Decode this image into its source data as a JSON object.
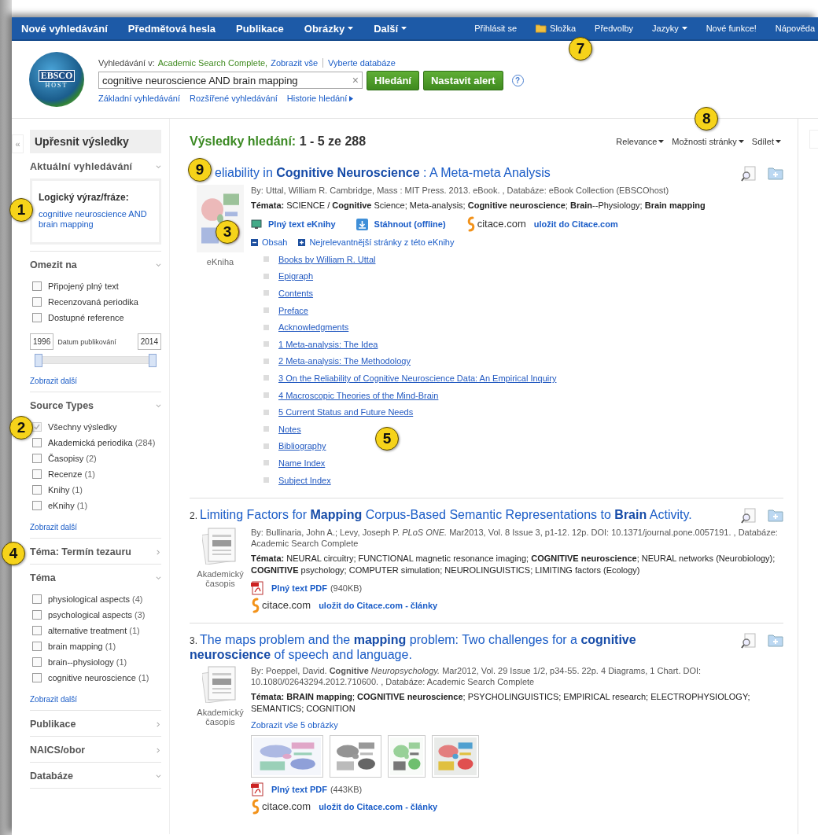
{
  "nav": {
    "left": [
      {
        "label": "Nové vyhledávání",
        "dropdown": false
      },
      {
        "label": "Předmětová hesla",
        "dropdown": false
      },
      {
        "label": "Publikace",
        "dropdown": false
      },
      {
        "label": "Obrázky",
        "dropdown": true
      },
      {
        "label": "Další",
        "dropdown": true
      }
    ],
    "right": [
      {
        "kind": "link",
        "label": "Přihlásit se",
        "dropdown": false
      },
      {
        "kind": "folder",
        "label": "Složka",
        "dropdown": false,
        "callout": "7"
      },
      {
        "kind": "link",
        "label": "Předvolby",
        "dropdown": false
      },
      {
        "kind": "link",
        "label": "Jazyky",
        "dropdown": true
      },
      {
        "kind": "link",
        "label": "Nové funkce!",
        "dropdown": false
      },
      {
        "kind": "link",
        "label": "Nápověda",
        "dropdown": false
      }
    ]
  },
  "header": {
    "logo": {
      "line1": "EBSCO",
      "line2": "HOST"
    },
    "prefix": "Vyhledávání v:",
    "database": "Academic Search Complete,",
    "show_all": "Zobrazit vše",
    "choose": "Vyberte databáze",
    "query": "cognitive neuroscience AND brain mapping",
    "clear": "×",
    "search_button": "Hledání",
    "alert_button": "Nastavit alert",
    "help": "?",
    "links": [
      "Základní vyhledávání",
      "Rozšířené vyhledávání",
      "Historie hledání"
    ]
  },
  "sidebar": {
    "collapse": "«",
    "title": "Upřesnit výsledky",
    "sections": [
      {
        "kind": "current",
        "title": "Aktuální vyhledávání",
        "expanded": true,
        "label": "Logický výraz/fráze:",
        "value": "cognitive neuroscience AND brain mapping",
        "callout": "1"
      },
      {
        "kind": "limits",
        "title": "Omezit na",
        "expanded": true,
        "items": [
          {
            "label": "Připojený plný text",
            "checked": false,
            "disabled": false
          },
          {
            "label": "Recenzovaná periodika",
            "checked": false,
            "disabled": false
          },
          {
            "label": "Dostupné reference",
            "checked": false,
            "disabled": false
          }
        ],
        "date": {
          "from": "1996",
          "label": "Datum publikování",
          "to": "2014",
          "thumbs": [
            {
              "level": 0
            },
            {
              "level": 1
            }
          ]
        },
        "more": "Zobrazit další"
      },
      {
        "kind": "checklist",
        "title": "Source Types",
        "expanded": true,
        "callout": "2",
        "items": [
          {
            "label": "Všechny výsledky",
            "checked": true,
            "disabled": true
          },
          {
            "label": "Akademická periodika",
            "count": "(284)",
            "checked": false,
            "disabled": false
          },
          {
            "label": "Časopisy",
            "count": "(2)",
            "checked": false,
            "disabled": false
          },
          {
            "label": "Recenze",
            "count": "(1)",
            "checked": false,
            "disabled": false
          },
          {
            "label": "Knihy",
            "count": "(1)",
            "checked": false,
            "disabled": false
          },
          {
            "label": "eKnihy",
            "count": "(1)",
            "checked": false,
            "disabled": false
          }
        ],
        "more": "Zobrazit další"
      },
      {
        "kind": "plain",
        "title": "Téma: Termín tezauru",
        "expanded": false,
        "callout": "4"
      },
      {
        "kind": "checklist",
        "title": "Téma",
        "expanded": true,
        "items": [
          {
            "label": "physiological aspects",
            "count": "(4)",
            "checked": false,
            "disabled": false
          },
          {
            "label": "psychological aspects",
            "count": "(3)",
            "checked": false,
            "disabled": false
          },
          {
            "label": "alternative treatment",
            "count": "(1)",
            "checked": false,
            "disabled": false
          },
          {
            "label": "brain mapping",
            "count": "(1)",
            "checked": false,
            "disabled": false
          },
          {
            "label": "brain--physiology",
            "count": "(1)",
            "checked": false,
            "disabled": false
          },
          {
            "label": "cognitive neuroscience",
            "count": "(1)",
            "checked": false,
            "disabled": false
          }
        ],
        "more": "Zobrazit další"
      },
      {
        "kind": "plain",
        "title": "Publikace",
        "expanded": false
      },
      {
        "kind": "plain",
        "title": "NAICS/obor",
        "expanded": false
      },
      {
        "kind": "plain",
        "title": "Databáze",
        "expanded": true
      }
    ]
  },
  "results": {
    "heading": "Výsledky hledání:",
    "range": "1 - 5 ze 288",
    "tools": [
      {
        "label": "Relevance"
      },
      {
        "label": "Možnosti stránky",
        "callout": "8"
      },
      {
        "label": "Sdílet"
      }
    ],
    "items": [
      {
        "kind": "ebook",
        "title": "eliability in **Cognitive Neuroscience** : A Meta-meta Analysis",
        "title_callout": "9",
        "cover_callout": "3",
        "type_label": "eKniha",
        "byline": "By: Uttal, William R. Cambridge, Mass : MIT Press. 2013. eBook. , Databáze: eBook Collection (EBSCOhost)",
        "subjects": "**Témata:** SCIENCE / **Cognitive** Science; Meta-analysis; **Cognitive neuroscience**; **Brain**--Physiology; **Brain mapping**",
        "actions": [
          {
            "kind": "ebook",
            "label": "Plný text eKnihy"
          },
          {
            "kind": "download",
            "label": "Stáhnout (offline)"
          },
          {
            "kind": "citace",
            "brand": "citace.com",
            "label": "uložit do Citace.com"
          }
        ],
        "toc": {
          "contents": {
            "label": "Obsah",
            "expanded": true
          },
          "relevant": {
            "label": "Nejrelevantnější stránky z této eKnihy",
            "expanded": false
          },
          "callout": "5",
          "entries": [
            "Books by William R. Uttal",
            "Epigraph",
            "Contents",
            "Preface",
            "Acknowledgments",
            "1 Meta-analysis: The Idea",
            "2 Meta-analysis: The Methodology",
            "3 On the Reliability of Cognitive Neuroscience Data: An Empirical Inquiry",
            "4 Macroscopic Theories of the Mind-Brain",
            "5 Current Status and Future Needs",
            "Notes",
            "Bibliography",
            "Name Index",
            "Subject Index"
          ]
        }
      },
      {
        "kind": "journal",
        "number": "2.",
        "title": "Limiting Factors for **Mapping** Corpus-Based Semantic Representations to **Brain** Activity.",
        "type_label": "Akademický časopis",
        "byline": "By: Bullinaria, John A.; Levy, Joseph P. *PLoS ONE.* Mar2013, Vol. 8 Issue 3, p1-12. 12p. DOI: 10.1371/journal.pone.0057191. , Databáze: Academic Search Complete",
        "subjects": "**Témata:** NEURAL circuitry; FUNCTIONAL magnetic resonance imaging; **COGNITIVE neuroscience**; NEURAL networks (Neurobiology); **COGNITIVE** psychology; COMPUTER simulation; NEUROLINGUISTICS; LIMITING factors (Ecology)",
        "actions": [
          {
            "kind": "pdf",
            "label": "Plný text PDF",
            "size": "(940KB)"
          },
          {
            "kind": "citace",
            "brand": "citace.com",
            "label": "uložit do Citace.com - články"
          }
        ]
      },
      {
        "kind": "journal",
        "number": "3.",
        "title": "The maps problem and the **mapping** problem: Two challenges for a **cognitive neuroscience** of speech and language.",
        "type_label": "Akademický časopis",
        "byline": "By: Poeppel, David. **Cognitive** *Neuropsychology.* Mar2012, Vol. 29 Issue 1/2, p34-55. 22p. 4 Diagrams, 1 Chart. DOI: 10.1080/02643294.2012.710600. , Databáze: Academic Search Complete",
        "subjects": "**Témata: BRAIN mapping**; **COGNITIVE neuroscience**; PSYCHOLINGUISTICS; EMPIRICAL research; ELECTROPHYSIOLOGY; SEMANTICS; COGNITION",
        "images": {
          "link": "Zobrazit vše 5 obrázky"
        },
        "actions": [
          {
            "kind": "pdf",
            "label": "Plný text PDF",
            "size": "(443KB)"
          },
          {
            "kind": "citace",
            "brand": "citace.com",
            "label": "uložit do Citace.com - články"
          }
        ]
      }
    ]
  }
}
